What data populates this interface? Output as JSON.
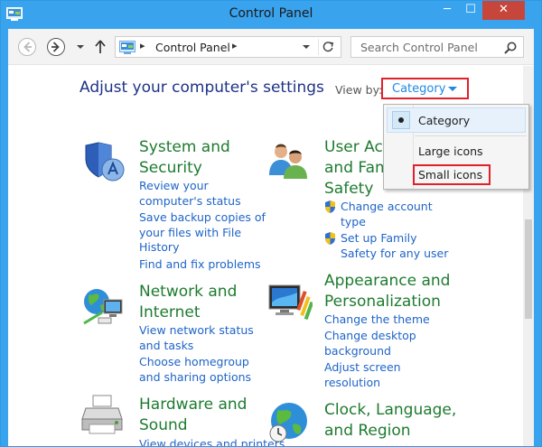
{
  "window": {
    "title": "Control Panel"
  },
  "titlebar": {
    "minimize": "─",
    "maximize": "☐",
    "close": "✕"
  },
  "nav": {
    "address": {
      "root_sep": "▸",
      "location": "Control Panel",
      "trail_sep": "▸"
    },
    "search": {
      "placeholder": "Search Control Panel"
    }
  },
  "main": {
    "heading": "Adjust your computer's settings",
    "view_by": {
      "label": "View by:",
      "value": "Category"
    }
  },
  "dropdown": {
    "items": [
      {
        "label": "Category",
        "selected": true
      },
      {
        "label": "Large icons",
        "selected": false
      },
      {
        "label": "Small icons",
        "selected": false
      }
    ]
  },
  "categories": {
    "system_security": {
      "icon": "shield-icon",
      "title_lines": [
        "System and",
        "Security"
      ],
      "links": [
        [
          "Review your",
          "computer's status"
        ],
        [
          "Save backup copies of",
          "your files with File",
          "History"
        ],
        [
          "Find and fix problems"
        ]
      ]
    },
    "user_accounts": {
      "icon": "users-icon",
      "title_lines": [
        "User Acc",
        "and Fam",
        "Safety"
      ],
      "links": [
        [
          "Change account",
          "type"
        ],
        [
          "Set up Family",
          "Safety for any user"
        ]
      ]
    },
    "network_internet": {
      "icon": "network-globe-icon",
      "title_lines": [
        "Network and",
        "Internet"
      ],
      "links": [
        [
          "View network status",
          "and tasks"
        ],
        [
          "Choose homegroup",
          "and sharing options"
        ]
      ]
    },
    "appearance": {
      "icon": "display-paint-icon",
      "title_lines": [
        "Appearance and",
        "Personalization"
      ],
      "links": [
        [
          "Change the theme"
        ],
        [
          "Change desktop",
          "background"
        ],
        [
          "Adjust screen",
          "resolution"
        ]
      ]
    },
    "hardware_sound": {
      "icon": "printer-icon",
      "title_lines": [
        "Hardware and",
        "Sound"
      ],
      "links": [
        [
          "View devices and printers"
        ]
      ]
    },
    "clock_language": {
      "icon": "clock-globe-icon",
      "title_lines": [
        "Clock, Language,",
        "and Region"
      ],
      "links": []
    }
  },
  "colors": {
    "titlebar": "#3aa3ee",
    "category_title": "#1d7b2f",
    "link": "#1e64c8",
    "heading": "#1e3287",
    "highlight_box": "#e0202a"
  }
}
